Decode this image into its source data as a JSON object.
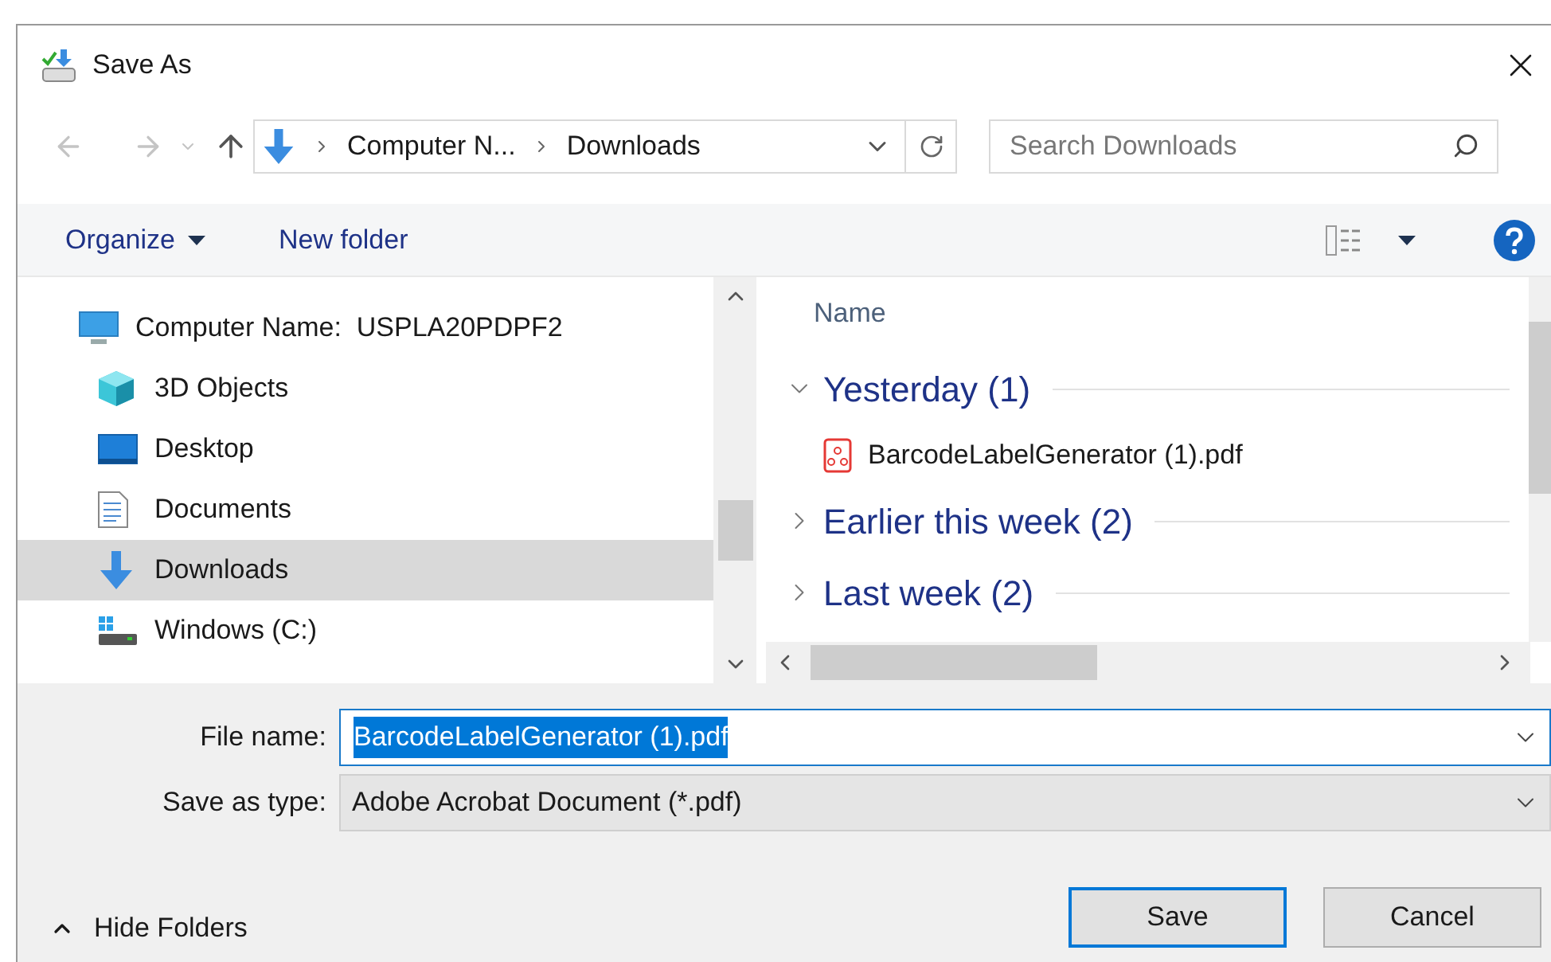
{
  "window": {
    "title": "Save As"
  },
  "address_bar": {
    "crumbs": [
      "Computer N...",
      "Downloads"
    ]
  },
  "search": {
    "placeholder": "Search Downloads"
  },
  "toolbar": {
    "organize": "Organize",
    "new_folder": "New folder"
  },
  "sidebar": {
    "items": [
      {
        "label": "Computer Name:  USPLA20PDPF2",
        "kind": "computer",
        "selected": false
      },
      {
        "label": "3D Objects",
        "kind": "objects",
        "selected": false
      },
      {
        "label": "Desktop",
        "kind": "desktop",
        "selected": false
      },
      {
        "label": "Documents",
        "kind": "documents",
        "selected": false
      },
      {
        "label": "Downloads",
        "kind": "downloads",
        "selected": true
      },
      {
        "label": "Windows (C:)",
        "kind": "drive",
        "selected": false
      }
    ]
  },
  "file_list": {
    "column": "Name",
    "groups": [
      {
        "label": "Yesterday (1)",
        "expanded": true,
        "items": [
          "BarcodeLabelGenerator (1).pdf"
        ]
      },
      {
        "label": "Earlier this week (2)",
        "expanded": false
      },
      {
        "label": "Last week (2)",
        "expanded": false
      }
    ]
  },
  "file_name": {
    "label": "File name:",
    "value": "BarcodeLabelGenerator (1).pdf",
    "text_selected": true
  },
  "save_as_type": {
    "label": "Save as type:",
    "value": "Adobe Acrobat Document (*.pdf)"
  },
  "hide_folders": "Hide Folders",
  "buttons": [
    {
      "label": "Save",
      "default": true
    },
    {
      "label": "Cancel",
      "default": false
    }
  ]
}
